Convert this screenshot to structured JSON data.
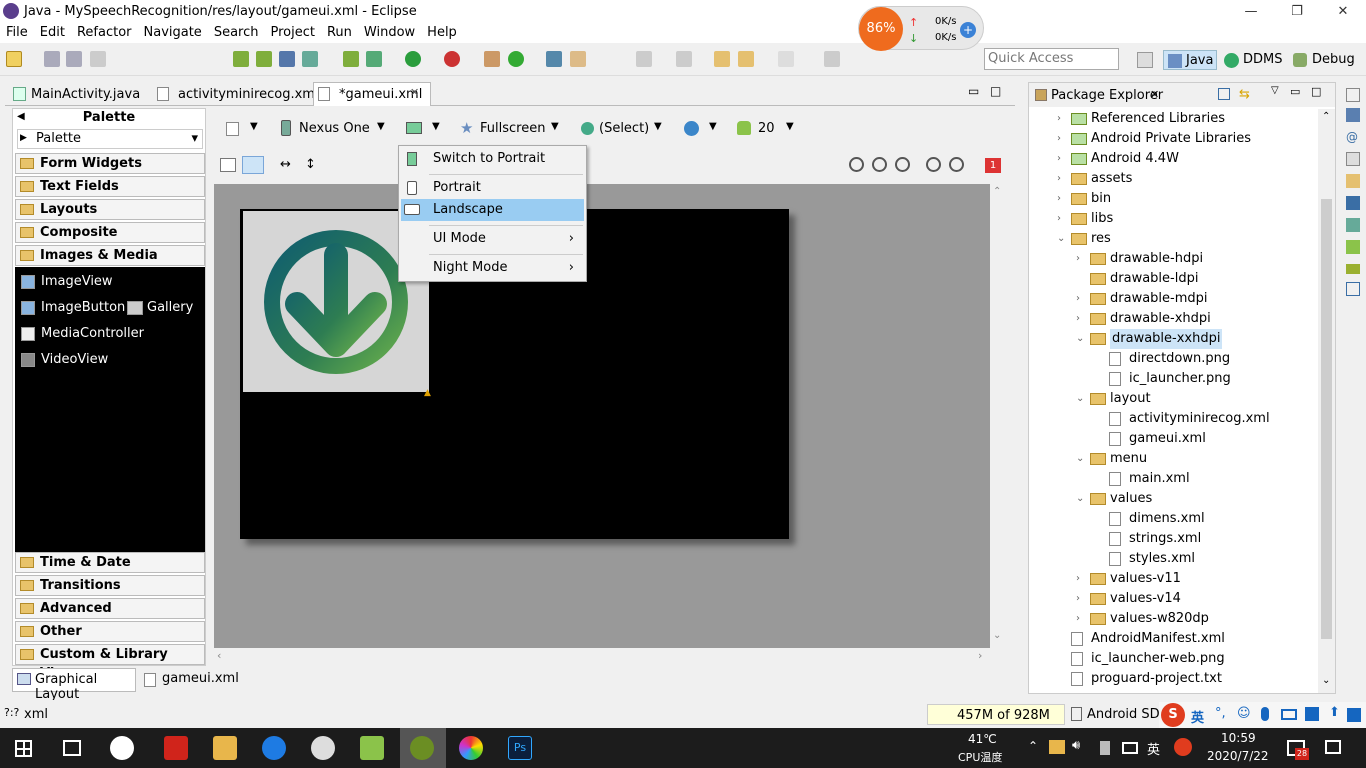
{
  "window": {
    "title": "Java - MySpeechRecognition/res/layout/gameui.xml - Eclipse"
  },
  "menu": [
    "File",
    "Edit",
    "Refactor",
    "Navigate",
    "Search",
    "Project",
    "Run",
    "Window",
    "Help"
  ],
  "netmonitor": {
    "percent": "86%",
    "up": "0K/s",
    "down": "0K/s"
  },
  "quick_access": {
    "placeholder": "Quick Access"
  },
  "perspectives": {
    "java": "Java",
    "ddms": "DDMS",
    "debug": "Debug"
  },
  "editor_tabs": [
    {
      "label": "MainActivity.java"
    },
    {
      "label": "activityminirecog.xml"
    },
    {
      "label": "*gameui.xml"
    }
  ],
  "palette": {
    "header": "Palette",
    "selector": "Palette",
    "categories_top": [
      "Form Widgets",
      "Text Fields",
      "Layouts",
      "Composite",
      "Images & Media"
    ],
    "media_items": {
      "imageview": "ImageView",
      "imagebutton": "ImageButton",
      "gallery": "Gallery",
      "mediacontroller": "MediaController",
      "videoview": "VideoView"
    },
    "categories_bottom": [
      "Time & Date",
      "Transitions",
      "Advanced",
      "Other",
      "Custom & Library Views"
    ]
  },
  "canvas_toolbar": {
    "device": "Nexus One",
    "theme": "Fullscreen",
    "activity": "(Select)",
    "api": "20",
    "error_count": "1"
  },
  "orientation_menu": {
    "items": {
      "switch": "Switch to Portrait",
      "portrait": "Portrait",
      "landscape": "Landscape",
      "uimode": "UI Mode",
      "night": "Night Mode"
    }
  },
  "bottom_tabs": {
    "graphical": "Graphical Layout",
    "xml": "gameui.xml"
  },
  "package_explorer": {
    "title": "Package Explorer",
    "items": [
      {
        "label": "Referenced Libraries",
        "icon": "library-icon",
        "toggle": "›"
      },
      {
        "label": "Android Private Libraries",
        "icon": "library-icon",
        "toggle": "›"
      },
      {
        "label": "Android 4.4W",
        "icon": "library-icon",
        "toggle": "›"
      },
      {
        "label": "assets",
        "icon": "folder-icon",
        "toggle": "›"
      },
      {
        "label": "bin",
        "icon": "folder-icon",
        "toggle": "›"
      },
      {
        "label": "libs",
        "icon": "folder-icon",
        "toggle": "›"
      },
      {
        "label": "res",
        "icon": "folder-icon",
        "toggle": "⌄"
      },
      {
        "label": "drawable-hdpi",
        "icon": "folder-icon",
        "toggle": "›"
      },
      {
        "label": "drawable-ldpi",
        "icon": "folder-icon",
        "toggle": ""
      },
      {
        "label": "drawable-mdpi",
        "icon": "folder-icon",
        "toggle": "›"
      },
      {
        "label": "drawable-xhdpi",
        "icon": "folder-icon",
        "toggle": "›"
      },
      {
        "label": "drawable-xxhdpi",
        "icon": "folder-icon",
        "toggle": "⌄"
      },
      {
        "label": "directdown.png",
        "icon": "image-file-icon",
        "toggle": ""
      },
      {
        "label": "ic_launcher.png",
        "icon": "image-file-icon",
        "toggle": ""
      },
      {
        "label": "layout",
        "icon": "folder-icon",
        "toggle": "⌄"
      },
      {
        "label": "activityminirecog.xml",
        "icon": "xml-file-icon",
        "toggle": ""
      },
      {
        "label": "gameui.xml",
        "icon": "xml-file-icon",
        "toggle": ""
      },
      {
        "label": "menu",
        "icon": "folder-icon",
        "toggle": "⌄"
      },
      {
        "label": "main.xml",
        "icon": "xml-file-icon",
        "toggle": ""
      },
      {
        "label": "values",
        "icon": "folder-icon",
        "toggle": "⌄"
      },
      {
        "label": "dimens.xml",
        "icon": "xml-file-icon",
        "toggle": ""
      },
      {
        "label": "strings.xml",
        "icon": "xml-file-icon",
        "toggle": ""
      },
      {
        "label": "styles.xml",
        "icon": "xml-file-icon",
        "toggle": ""
      },
      {
        "label": "values-v11",
        "icon": "folder-icon",
        "toggle": "›"
      },
      {
        "label": "values-v14",
        "icon": "folder-icon",
        "toggle": "›"
      },
      {
        "label": "values-w820dp",
        "icon": "folder-icon",
        "toggle": "›"
      },
      {
        "label": "AndroidManifest.xml",
        "icon": "xml-file-icon",
        "toggle": ""
      },
      {
        "label": "ic_launcher-web.png",
        "icon": "image-file-icon",
        "toggle": ""
      },
      {
        "label": "proguard-project.txt",
        "icon": "text-file-icon",
        "toggle": ""
      }
    ]
  },
  "status": {
    "left": "xml",
    "memory": "457M of 928M",
    "sdk": "Android SDK"
  },
  "taskbar": {
    "temp": "41℃",
    "temp_label": "CPU温度",
    "ime": "英",
    "time": "10:59",
    "date": "2020/7/22",
    "notif": "28"
  },
  "colors": {
    "accent": "#99ccf2",
    "netmonitor": "#ef6b1e"
  }
}
